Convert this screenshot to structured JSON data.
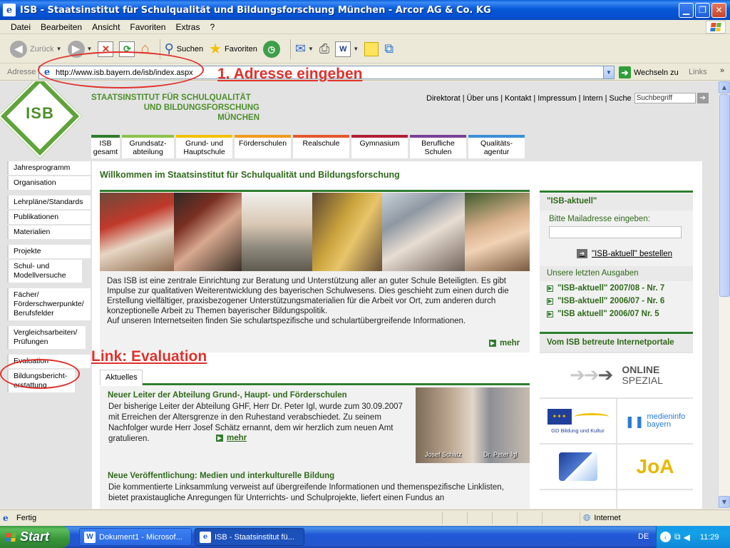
{
  "window": {
    "title": "ISB - Staatsinstitut für Schulqualität und Bildungsforschung München - Arcor AG & Co. KG"
  },
  "menubar": [
    "Datei",
    "Bearbeiten",
    "Ansicht",
    "Favoriten",
    "Extras",
    "?"
  ],
  "toolbar": {
    "back": "Zurück",
    "search": "Suchen",
    "favorites": "Favoriten"
  },
  "addressbar": {
    "label": "Adresse",
    "url": "http://www.isb.bayern.de/isb/index.aspx",
    "go": "Wechseln zu",
    "links": "Links"
  },
  "annotations": {
    "step1": "1. Adresse eingeben",
    "link_eval": "Link: Evaluation"
  },
  "isb": {
    "logo_text": "ISB",
    "name_line1": "STAATSINSTITUT FÜR SCHULQUALITÄT",
    "name_line2": "UND BILDUNGSFORSCHUNG",
    "name_line3": "MÜNCHEN",
    "toplinks": [
      "Direktorat",
      "Über uns",
      "Kontakt",
      "Impressum",
      "Intern",
      "Suche"
    ],
    "search_placeholder": "Suchbegriff",
    "tabs": [
      {
        "l1": "ISB",
        "l2": "gesamt",
        "color": "#2F7D2E"
      },
      {
        "l1": "Grundsatz-",
        "l2": "abteilung",
        "color": "#8BC34A"
      },
      {
        "l1": "Grund- und",
        "l2": "Hauptschule",
        "color": "#F2C200"
      },
      {
        "l1": "Förderschulen",
        "l2": "",
        "color": "#F29A1D"
      },
      {
        "l1": "Realschule",
        "l2": "",
        "color": "#E4572E"
      },
      {
        "l1": "Gymnasium",
        "l2": "",
        "color": "#B21E35"
      },
      {
        "l1": "Berufliche",
        "l2": "Schulen",
        "color": "#7B3F98"
      },
      {
        "l1": "Qualitäts-",
        "l2": "agentur",
        "color": "#3A8FD8"
      }
    ],
    "sidenav": [
      "Jahresprogramm",
      "Organisation",
      "Lehrpläne/Standards",
      "Publikationen",
      "Materialien",
      "Projekte",
      "Schul- und Modellversuche",
      "Fächer/ Förderschwerpunkte/ Berufsfelder",
      "Vergleichsarbeiten/ Prüfungen",
      "Evaluation",
      "Bildungsbericht-erstattung"
    ],
    "welcome": "Willkommen im Staatsinstitut für Schulqualität und Bildungsforschung",
    "intro": "Das ISB ist eine zentrale Einrichtung zur Beratung und Unterstützung aller an guter Schule Beteiligten. Es gibt Impulse zur qualitativen Weiterentwicklung des bayerischen Schulwesens. Dies geschieht zum einen durch die Erstellung vielfältiger, praxisbezogener Unterstützungsmaterialien für die Arbeit vor Ort, zum anderen durch konzeptionelle Arbeit zu Themen bayerischer Bildungspolitik.",
    "intro2": "Auf unseren Internetseiten finden Sie schulartspezifische und schulartübergreifende Informationen.",
    "mehr": "mehr",
    "aktuelles_tab": "Aktuelles",
    "news": [
      {
        "title": "Neuer Leiter der Abteilung Grund-, Haupt- und Förderschulen",
        "text": "Der bisherige Leiter der Abteilung GHF, Herr Dr. Peter Igl, wurde zum 30.09.2007 mit Erreichen der Altersgrenze in den Ruhestand verabschiedet. Zu seinem Nachfolger wurde Herr Josef Schätz ernannt, dem wir herzlich zum neuen Amt gratulieren.",
        "mehr": "mehr",
        "photo_caption_left": "Josef Schätz",
        "photo_caption_right": "Dr. Peter Igl"
      },
      {
        "title": "Neue Veröffentlichung: Medien und interkulturelle Bildung",
        "text": "Die kommentierte Linksammlung verweist auf übergreifende Informationen und themenspezifische Linklisten, bietet praxistaugliche Anregungen für Unterrichts- und Schulprojekte, liefert einen Fundus an"
      }
    ],
    "right": {
      "aktuell_head": "\"ISB-aktuell\"",
      "mail_label": "Bitte Mailadresse eingeben:",
      "bestellen": "\"ISB-aktuell\" bestellen",
      "issues_head": "Unsere letzten Ausgaben",
      "issues": [
        "\"ISB-aktuell\" 2007/08 - Nr. 7",
        "\"ISB-aktuell\" 2006/07 - Nr. 6",
        "\"ISB aktuell\" 2006/07 Nr. 5"
      ],
      "portale_head": "Vom ISB betreute Internetportale",
      "online_l1": "ONLINE",
      "online_l2": "SPEZIAL",
      "gd_label": "GD Bildung und Kultur",
      "medieninfo_l1": "medieninfo",
      "medieninfo_l2": "bayern",
      "joa": "JoA"
    }
  },
  "statusbar": {
    "left": "Fertig",
    "zone": "Internet"
  },
  "taskbar": {
    "start": "Start",
    "tasks": [
      "Dokument1 - Microsof...",
      "ISB - Staatsinstitut fü..."
    ],
    "lang": "DE",
    "time": "11:29"
  },
  "colors": {
    "isb_green": "#4E8F2C",
    "annotation_red": "#E0312B"
  }
}
